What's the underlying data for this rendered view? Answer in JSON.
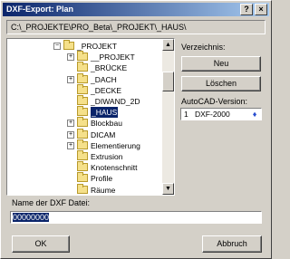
{
  "window": {
    "title": "DXF-Export: Plan",
    "help_label": "?",
    "close_label": "×"
  },
  "path": "C:\\_PROJEKTE\\PRO_Beta\\_PROJEKT\\_HAUS\\",
  "tree": {
    "items": [
      {
        "label": "_PROJEKT",
        "expander": "−"
      },
      {
        "label": "__PROJEKT",
        "expander": "+"
      },
      {
        "label": "_BRÜCKE",
        "expander": ""
      },
      {
        "label": "_DACH",
        "expander": "+"
      },
      {
        "label": "_DECKE",
        "expander": ""
      },
      {
        "label": "_DIWAND_2D",
        "expander": ""
      },
      {
        "label": "_HAUS",
        "expander": "",
        "selected": true
      },
      {
        "label": "Blockbau",
        "expander": "+"
      },
      {
        "label": "DICAM",
        "expander": "+"
      },
      {
        "label": "Elementierung",
        "expander": "+"
      },
      {
        "label": "Extrusion",
        "expander": ""
      },
      {
        "label": "Knotenschnitt",
        "expander": ""
      },
      {
        "label": "Profile",
        "expander": ""
      },
      {
        "label": "Räume",
        "expander": ""
      }
    ]
  },
  "scrollbar": {
    "up": "▲",
    "down": "▼"
  },
  "directory": {
    "label": "Verzeichnis:",
    "new_label": "Neu",
    "delete_label": "Löschen"
  },
  "autocad": {
    "label": "AutoCAD-Version:",
    "index": "1",
    "value": "DXF-2000",
    "arrow": "♦"
  },
  "file": {
    "label": "Name der DXF Datei:",
    "value": "00000000"
  },
  "buttons": {
    "ok": "OK",
    "cancel": "Abbruch"
  }
}
